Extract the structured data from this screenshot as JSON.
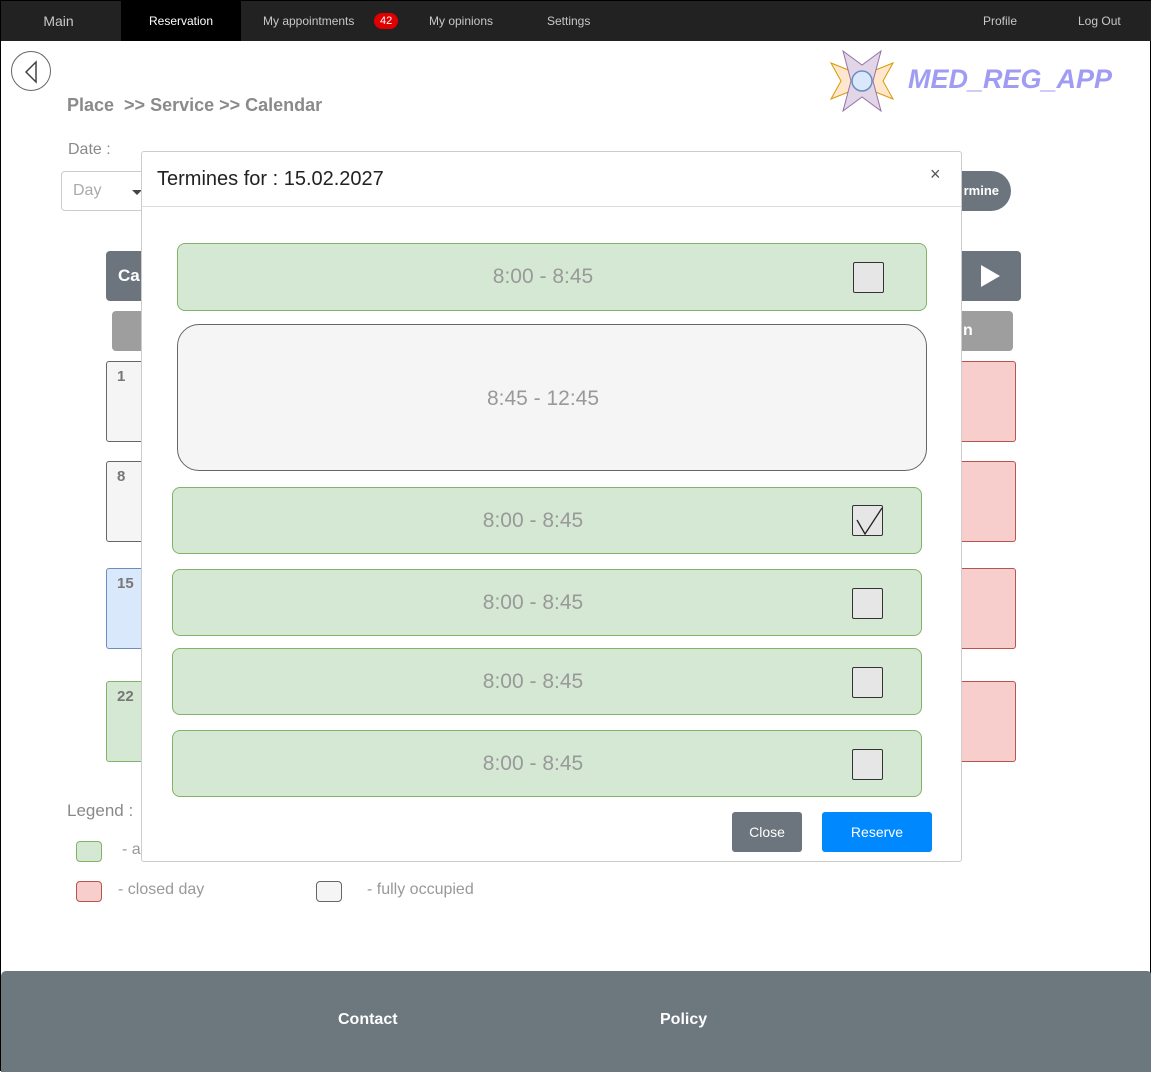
{
  "nav": {
    "main": "Main",
    "reservation": "Reservation",
    "appointments": "My appointments",
    "appointments_count": "42",
    "opinions": "My opinions",
    "settings": "Settings",
    "profile": "Profile",
    "logout": "Log Out"
  },
  "brand": {
    "name": "MED_REG_APP"
  },
  "breadcrumb": "Place  >> Service >> Calendar",
  "date_filter": {
    "label": "Date :",
    "day_value": "Day"
  },
  "termine_button": "rmine",
  "calendar": {
    "header_partial": "Ca",
    "dow_partial": "n",
    "week_start_days": [
      "1",
      "8",
      "15",
      "22"
    ]
  },
  "legend": {
    "title": "Legend :",
    "available_partial": "- a",
    "closed": "- closed day",
    "occupied": "- fully occupied"
  },
  "footer": {
    "contact": "Contact",
    "policy": "Policy"
  },
  "modal": {
    "title": "Termines for : 15.02.2027",
    "close_icon": "×",
    "slots": [
      {
        "time": "8:00  - 8:45",
        "status": "available",
        "checked": false
      },
      {
        "time": "8:45  - 12:45",
        "status": "occupied",
        "checked": false
      },
      {
        "time": "8:00  - 8:45",
        "status": "available",
        "checked": true
      },
      {
        "time": "8:00  - 8:45",
        "status": "available",
        "checked": false
      },
      {
        "time": "8:00  - 8:45",
        "status": "available",
        "checked": false
      },
      {
        "time": "8:00  - 8:45",
        "status": "available",
        "checked": false
      }
    ],
    "close_label": "Close",
    "reserve_label": "Reserve"
  },
  "colors": {
    "available": "#d5e8d4",
    "closed": "#f8cecc",
    "occupied": "#f5f5f5",
    "selected": "#dae8fc",
    "reserve": "#0088ff",
    "brand": "#a19cf3"
  }
}
